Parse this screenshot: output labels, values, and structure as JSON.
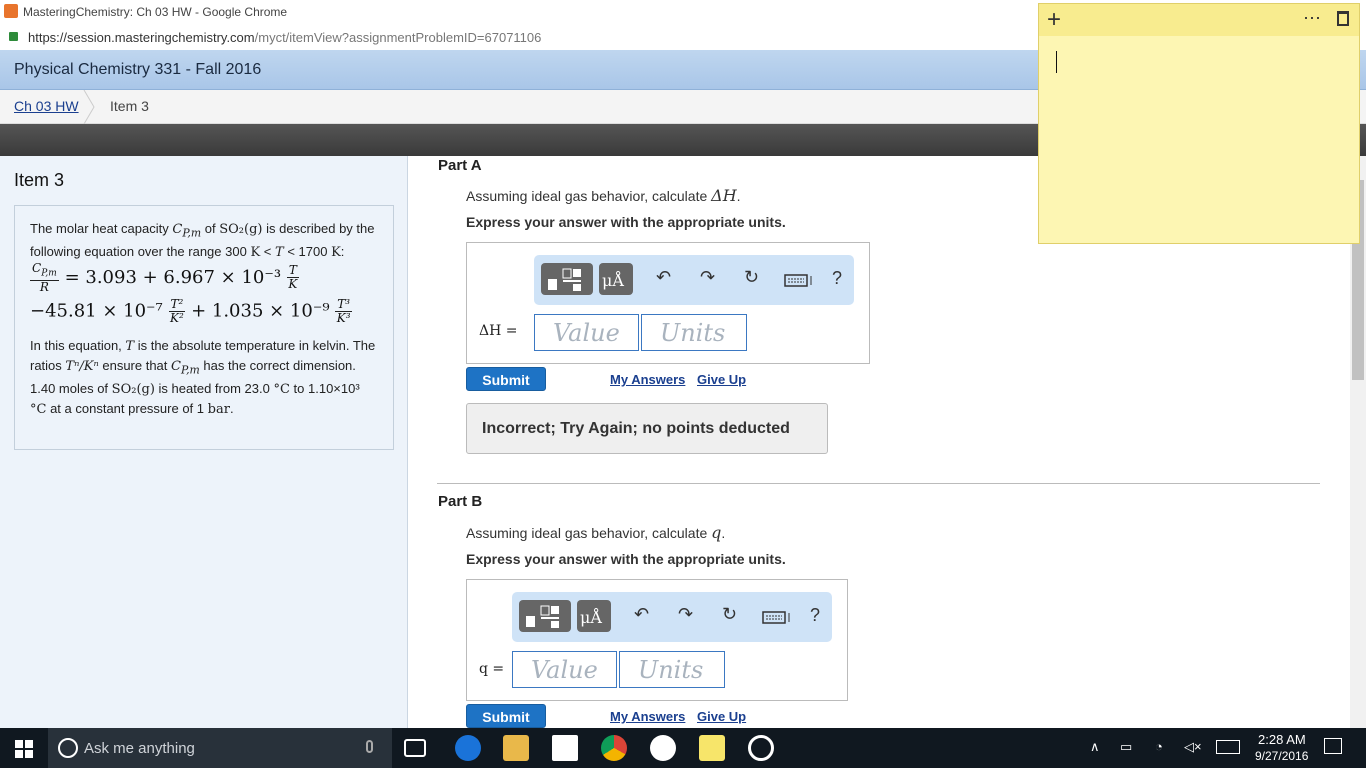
{
  "browser": {
    "title": "MasteringChemistry: Ch 03 HW - Google Chrome",
    "url_host": "https://session.masteringchemistry.com",
    "url_path": "/myct/itemView?assignmentProblemID=67071106"
  },
  "course": {
    "title": "Physical Chemistry 331 - Fall 2016"
  },
  "breadcrumb": {
    "assignment": "Ch 03 HW",
    "item": "Item 3"
  },
  "item_title": "Item 3",
  "problem": {
    "intro_a": "The molar heat capacity",
    "intro_b": "of",
    "intro_c": "is described by the following equation over the range 300",
    "intro_d": "1700",
    "cp_symbol": "C",
    "cp_sub": "P,m",
    "so2": "SO₂(g)",
    "eq_line1": "= 3.093 + 6.967 × 10⁻³",
    "eq_line2_a": "−45.81 × 10⁻⁷",
    "eq_line2_b": "+ 1.035 × 10⁻⁹",
    "frac1_num": "T",
    "frac1_den": "K",
    "frac2_num": "T²",
    "frac2_den": "K²",
    "frac3_num": "T³",
    "frac3_den": "K³",
    "cp_frac_num": "C",
    "cp_frac_den": "R",
    "text_1": "In this equation,",
    "text_2": "is the absolute temperature in kelvin. The ratios",
    "ratio": "Tⁿ/Kⁿ",
    "text_3": "ensure that",
    "text_4": "has the correct dimension. 1.40 moles of",
    "text_5": "is heated from 23.0",
    "text_6": "to 1.10×10³",
    "text_7": "at a constant pressure of 1",
    "unit_c": "°C",
    "unit_bar": "bar",
    "T": "T",
    "K": "K",
    "lt": "<"
  },
  "parts": [
    {
      "title": "Part A",
      "question_prefix": "Assuming ideal gas behavior, calculate",
      "question_symbol": "ΔH",
      "instruction": "Express your answer with the appropriate units.",
      "answer_label": "ΔH =",
      "value_placeholder": "Value",
      "units_placeholder": "Units",
      "submit": "Submit",
      "my_answers": "My Answers",
      "give_up": "Give Up",
      "feedback": "Incorrect; Try Again; no points deducted"
    },
    {
      "title": "Part B",
      "question_prefix": "Assuming ideal gas behavior, calculate",
      "question_symbol": "q",
      "instruction": "Express your answer with the appropriate units.",
      "answer_label": "q =",
      "value_placeholder": "Value",
      "units_placeholder": "Units",
      "submit": "Submit",
      "my_answers": "My Answers",
      "give_up": "Give Up"
    }
  ],
  "toolbar": {
    "mu_label": "μÅ",
    "help": "?"
  },
  "taskbar": {
    "search_placeholder": "Ask me anything",
    "time": "2:28 AM",
    "date": "9/27/2016"
  }
}
